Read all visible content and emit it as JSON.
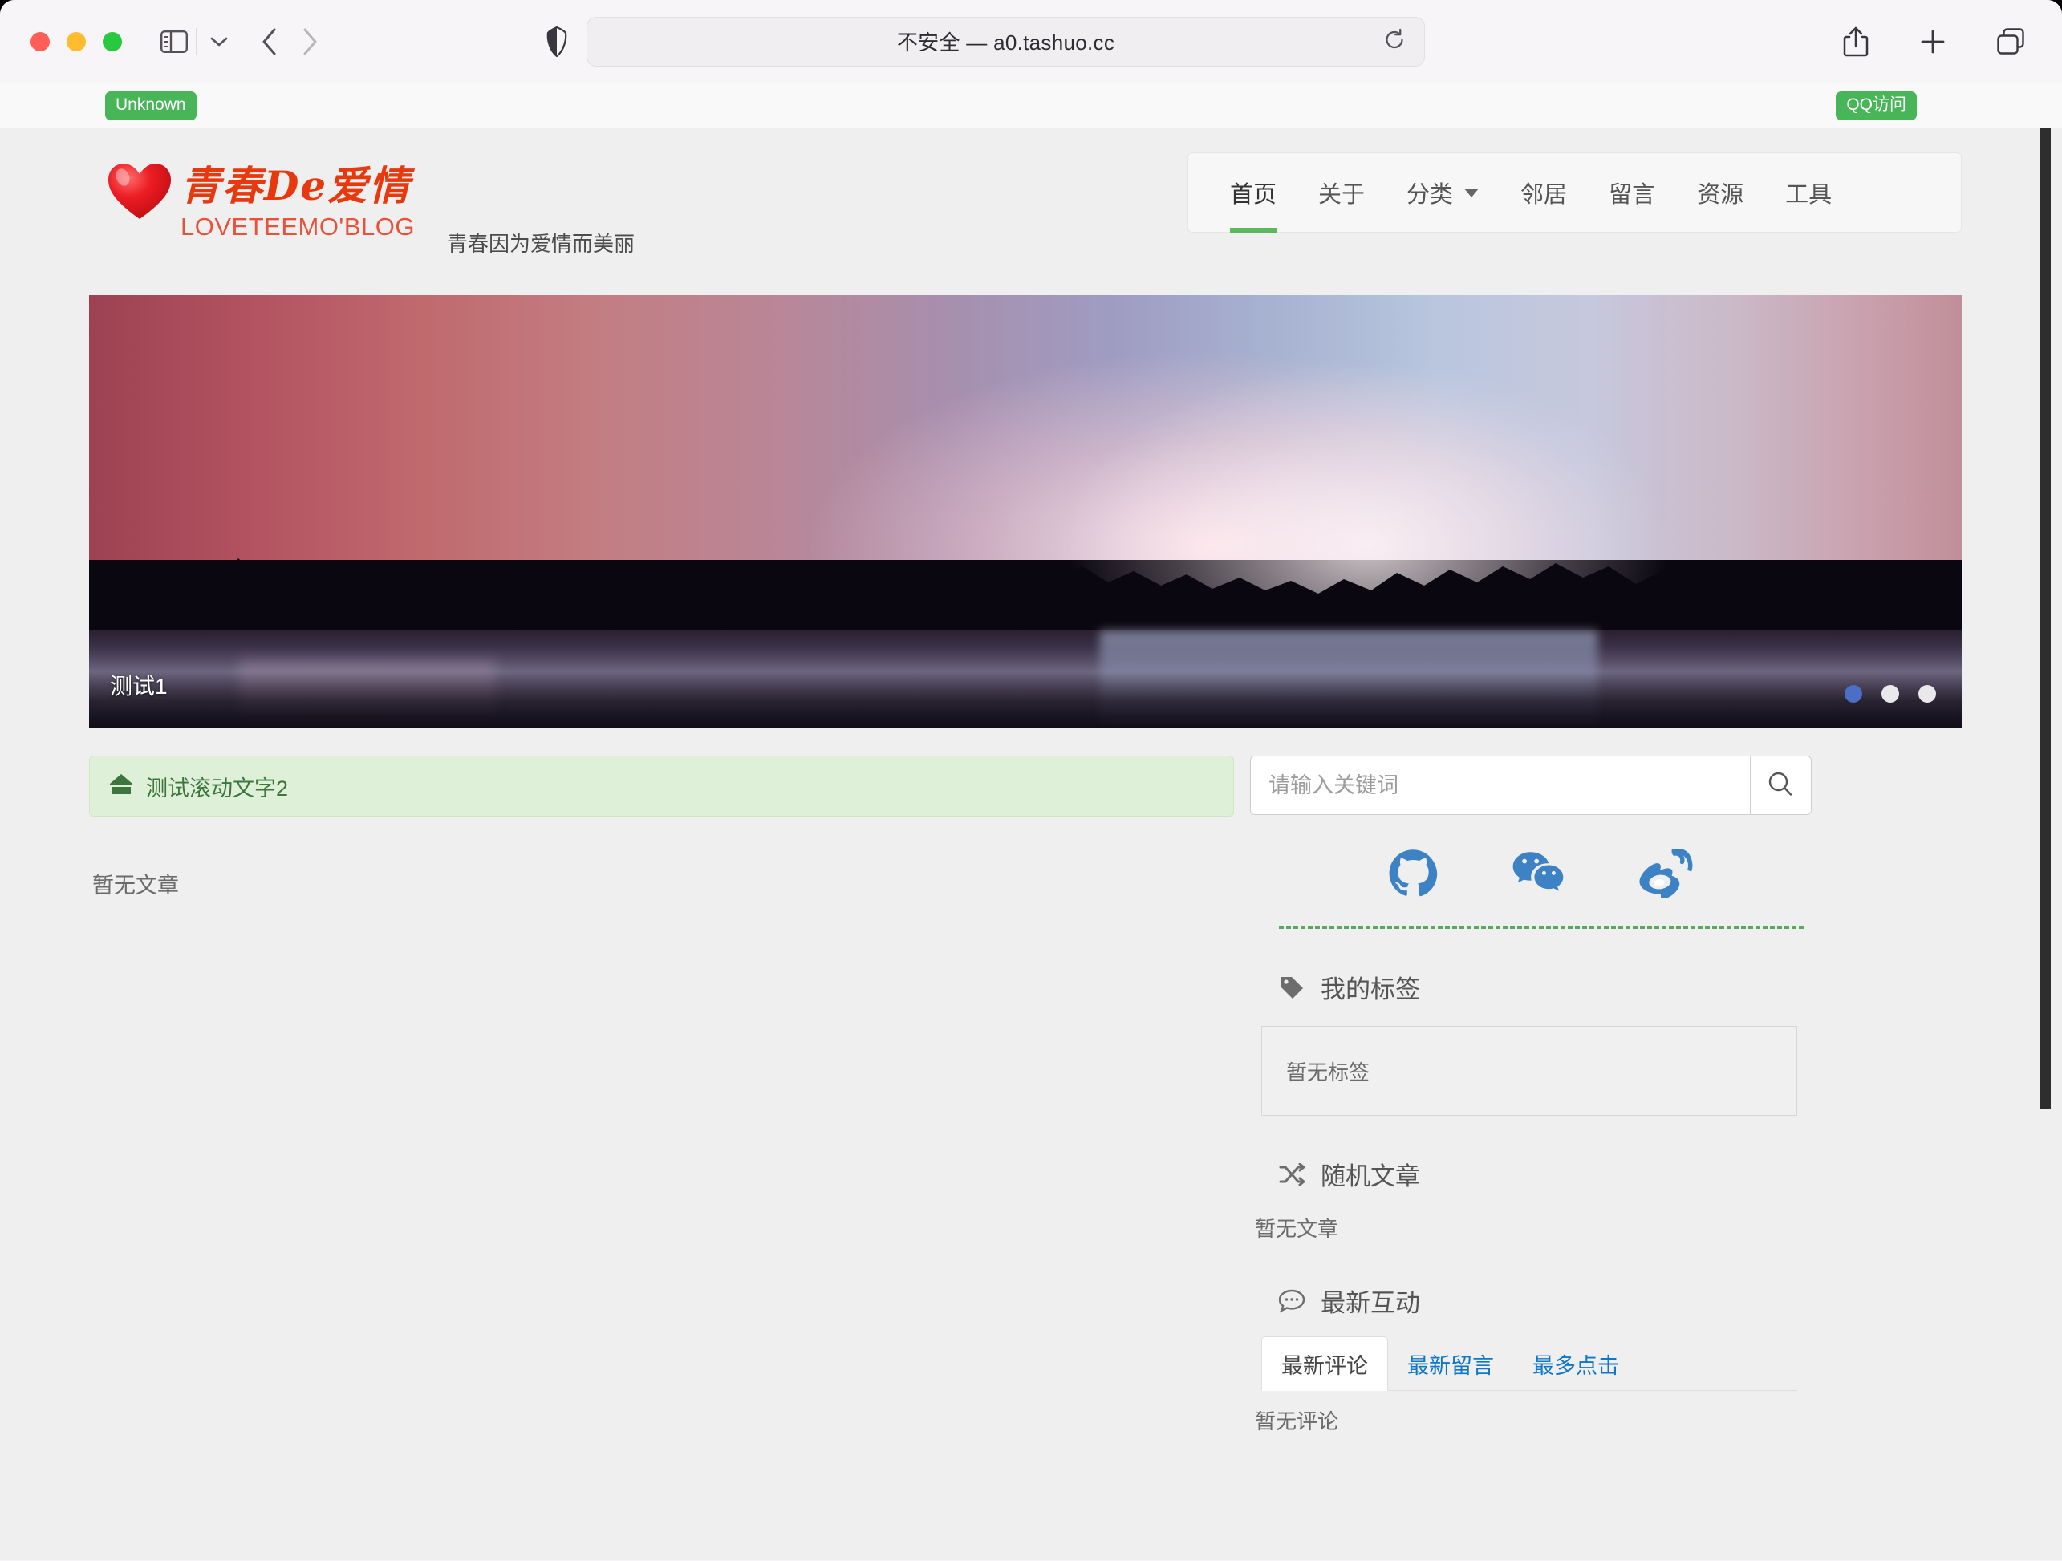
{
  "browser": {
    "url_text": "不安全 — a0.tashuo.cc",
    "icons": {
      "sidebar": "sidebar-icon",
      "sidebar_chevron": "chevron-down-icon",
      "back": "back-chevron-icon",
      "forward": "forward-chevron-icon",
      "shield": "privacy-shield-icon",
      "reload": "reload-icon",
      "share": "share-icon",
      "new_tab": "plus-icon",
      "tab_overview": "tab-overview-icon"
    },
    "bookmarks": [
      {
        "label": "Unknown",
        "color": "#48b558"
      },
      {
        "label": "QQ访问",
        "color": "#48b558"
      }
    ]
  },
  "site": {
    "logo_cn": "青春De爱情",
    "logo_en": "LOVETEEMO'BLOG",
    "tagline": "青春因为爱情而美丽",
    "accent_color": "#5cb85c",
    "logo_color": "#e8380d",
    "nav": [
      {
        "label": "首页",
        "active": true,
        "has_caret": false
      },
      {
        "label": "关于",
        "active": false,
        "has_caret": false
      },
      {
        "label": "分类",
        "active": false,
        "has_caret": true
      },
      {
        "label": "邻居",
        "active": false,
        "has_caret": false
      },
      {
        "label": "留言",
        "active": false,
        "has_caret": false
      },
      {
        "label": "资源",
        "active": false,
        "has_caret": false
      },
      {
        "label": "工具",
        "active": false,
        "has_caret": false
      }
    ]
  },
  "carousel": {
    "caption": "测试1",
    "slide_count": 3,
    "active_index": 0,
    "active_dot_color": "#4a6fc4",
    "inactive_dot_color": "#e9e9ec"
  },
  "main": {
    "notice_text": "测试滚动文字2",
    "notice_icon": "megaphone-icon",
    "notice_bg": "#dff0d8",
    "notice_color": "#3c763d",
    "empty_articles": "暂无文章"
  },
  "sidebar": {
    "search": {
      "placeholder": "请输入关键词",
      "value": "",
      "button_icon": "search-icon"
    },
    "social": [
      {
        "name": "github-icon",
        "color": "#3c82c4"
      },
      {
        "name": "wechat-icon",
        "color": "#3c82c4"
      },
      {
        "name": "weibo-icon",
        "color": "#3c82c4"
      }
    ],
    "tags_section": {
      "icon": "tag-icon",
      "title": "我的标签",
      "empty": "暂无标签"
    },
    "random_section": {
      "icon": "shuffle-icon",
      "title": "随机文章",
      "empty": "暂无文章"
    },
    "interaction_section": {
      "icon": "comment-icon",
      "title": "最新互动",
      "tabs": [
        {
          "label": "最新评论",
          "active": true
        },
        {
          "label": "最新留言",
          "active": false
        },
        {
          "label": "最多点击",
          "active": false
        }
      ],
      "empty": "暂无评论"
    }
  }
}
